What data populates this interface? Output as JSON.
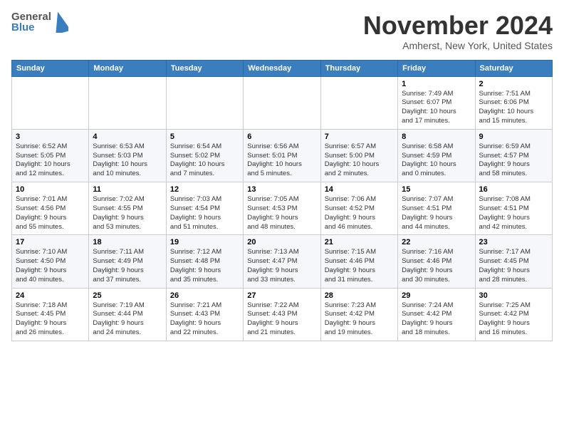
{
  "header": {
    "logo_general": "General",
    "logo_blue": "Blue",
    "month_title": "November 2024",
    "location": "Amherst, New York, United States"
  },
  "calendar": {
    "day_headers": [
      "Sunday",
      "Monday",
      "Tuesday",
      "Wednesday",
      "Thursday",
      "Friday",
      "Saturday"
    ],
    "weeks": [
      [
        {
          "day": "",
          "info": ""
        },
        {
          "day": "",
          "info": ""
        },
        {
          "day": "",
          "info": ""
        },
        {
          "day": "",
          "info": ""
        },
        {
          "day": "",
          "info": ""
        },
        {
          "day": "1",
          "info": "Sunrise: 7:49 AM\nSunset: 6:07 PM\nDaylight: 10 hours\nand 17 minutes."
        },
        {
          "day": "2",
          "info": "Sunrise: 7:51 AM\nSunset: 6:06 PM\nDaylight: 10 hours\nand 15 minutes."
        }
      ],
      [
        {
          "day": "3",
          "info": "Sunrise: 6:52 AM\nSunset: 5:05 PM\nDaylight: 10 hours\nand 12 minutes."
        },
        {
          "day": "4",
          "info": "Sunrise: 6:53 AM\nSunset: 5:03 PM\nDaylight: 10 hours\nand 10 minutes."
        },
        {
          "day": "5",
          "info": "Sunrise: 6:54 AM\nSunset: 5:02 PM\nDaylight: 10 hours\nand 7 minutes."
        },
        {
          "day": "6",
          "info": "Sunrise: 6:56 AM\nSunset: 5:01 PM\nDaylight: 10 hours\nand 5 minutes."
        },
        {
          "day": "7",
          "info": "Sunrise: 6:57 AM\nSunset: 5:00 PM\nDaylight: 10 hours\nand 2 minutes."
        },
        {
          "day": "8",
          "info": "Sunrise: 6:58 AM\nSunset: 4:59 PM\nDaylight: 10 hours\nand 0 minutes."
        },
        {
          "day": "9",
          "info": "Sunrise: 6:59 AM\nSunset: 4:57 PM\nDaylight: 9 hours\nand 58 minutes."
        }
      ],
      [
        {
          "day": "10",
          "info": "Sunrise: 7:01 AM\nSunset: 4:56 PM\nDaylight: 9 hours\nand 55 minutes."
        },
        {
          "day": "11",
          "info": "Sunrise: 7:02 AM\nSunset: 4:55 PM\nDaylight: 9 hours\nand 53 minutes."
        },
        {
          "day": "12",
          "info": "Sunrise: 7:03 AM\nSunset: 4:54 PM\nDaylight: 9 hours\nand 51 minutes."
        },
        {
          "day": "13",
          "info": "Sunrise: 7:05 AM\nSunset: 4:53 PM\nDaylight: 9 hours\nand 48 minutes."
        },
        {
          "day": "14",
          "info": "Sunrise: 7:06 AM\nSunset: 4:52 PM\nDaylight: 9 hours\nand 46 minutes."
        },
        {
          "day": "15",
          "info": "Sunrise: 7:07 AM\nSunset: 4:51 PM\nDaylight: 9 hours\nand 44 minutes."
        },
        {
          "day": "16",
          "info": "Sunrise: 7:08 AM\nSunset: 4:51 PM\nDaylight: 9 hours\nand 42 minutes."
        }
      ],
      [
        {
          "day": "17",
          "info": "Sunrise: 7:10 AM\nSunset: 4:50 PM\nDaylight: 9 hours\nand 40 minutes."
        },
        {
          "day": "18",
          "info": "Sunrise: 7:11 AM\nSunset: 4:49 PM\nDaylight: 9 hours\nand 37 minutes."
        },
        {
          "day": "19",
          "info": "Sunrise: 7:12 AM\nSunset: 4:48 PM\nDaylight: 9 hours\nand 35 minutes."
        },
        {
          "day": "20",
          "info": "Sunrise: 7:13 AM\nSunset: 4:47 PM\nDaylight: 9 hours\nand 33 minutes."
        },
        {
          "day": "21",
          "info": "Sunrise: 7:15 AM\nSunset: 4:46 PM\nDaylight: 9 hours\nand 31 minutes."
        },
        {
          "day": "22",
          "info": "Sunrise: 7:16 AM\nSunset: 4:46 PM\nDaylight: 9 hours\nand 30 minutes."
        },
        {
          "day": "23",
          "info": "Sunrise: 7:17 AM\nSunset: 4:45 PM\nDaylight: 9 hours\nand 28 minutes."
        }
      ],
      [
        {
          "day": "24",
          "info": "Sunrise: 7:18 AM\nSunset: 4:45 PM\nDaylight: 9 hours\nand 26 minutes."
        },
        {
          "day": "25",
          "info": "Sunrise: 7:19 AM\nSunset: 4:44 PM\nDaylight: 9 hours\nand 24 minutes."
        },
        {
          "day": "26",
          "info": "Sunrise: 7:21 AM\nSunset: 4:43 PM\nDaylight: 9 hours\nand 22 minutes."
        },
        {
          "day": "27",
          "info": "Sunrise: 7:22 AM\nSunset: 4:43 PM\nDaylight: 9 hours\nand 21 minutes."
        },
        {
          "day": "28",
          "info": "Sunrise: 7:23 AM\nSunset: 4:42 PM\nDaylight: 9 hours\nand 19 minutes."
        },
        {
          "day": "29",
          "info": "Sunrise: 7:24 AM\nSunset: 4:42 PM\nDaylight: 9 hours\nand 18 minutes."
        },
        {
          "day": "30",
          "info": "Sunrise: 7:25 AM\nSunset: 4:42 PM\nDaylight: 9 hours\nand 16 minutes."
        }
      ]
    ]
  }
}
